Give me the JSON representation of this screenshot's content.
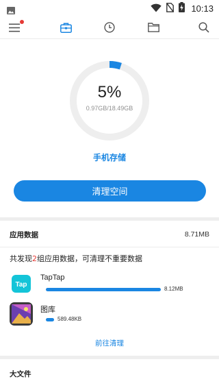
{
  "status_bar": {
    "time": "10:13",
    "icons": [
      "image-icon",
      "wifi-icon",
      "no-sim-icon",
      "battery-charging-icon"
    ]
  },
  "toolbar": {
    "icons": [
      "menu-icon",
      "toolbox-icon",
      "clock-icon",
      "folder-icon",
      "search-icon"
    ],
    "active": "toolbox-icon",
    "notification_dot": true
  },
  "storage": {
    "percent": "5%",
    "usage": "0.97GB/18.49GB",
    "used_fraction": 0.05,
    "label": "手机存储",
    "clean_button": "清理空间"
  },
  "app_data": {
    "title": "应用数据",
    "total": "8.71MB",
    "summary_prefix": "共发现",
    "summary_count": "2",
    "summary_suffix": "组应用数据，可清理不重要数据",
    "apps": [
      {
        "name": "TapTap",
        "size": "8.12MB",
        "fraction": 0.932,
        "icon": "taptap-icon"
      },
      {
        "name": "图库",
        "size": "589.48KB",
        "fraction": 0.066,
        "icon": "gallery-icon"
      }
    ],
    "goto_clean": "前往清理"
  },
  "big_files": {
    "title": "大文件"
  },
  "colors": {
    "accent": "#1a86e2",
    "highlight": "#e53935",
    "ring_track": "#eeeeee",
    "section_gap": "#eeeeee"
  }
}
